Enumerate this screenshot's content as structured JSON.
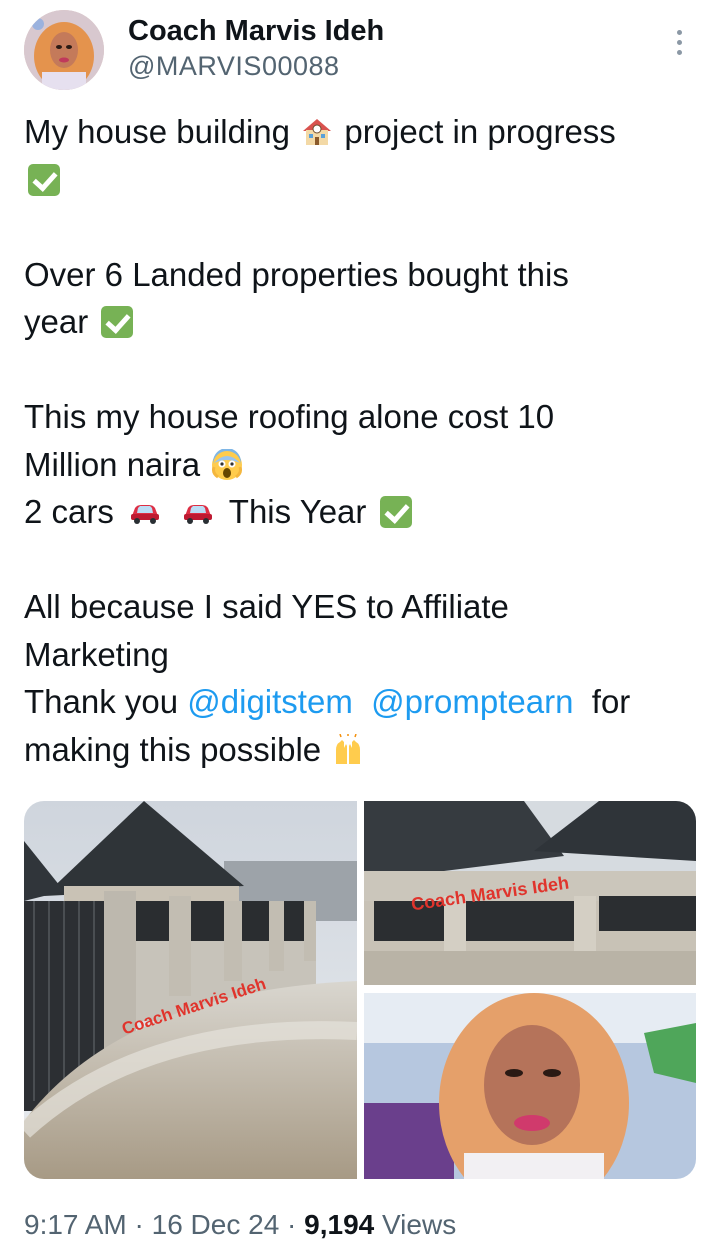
{
  "author": {
    "name": "Coach Marvis Ideh",
    "handle": "@MARVIS00088"
  },
  "tweet": {
    "line1_a": "My house building",
    "line1_b": "project in progress",
    "line2": "Over 6 Landed properties bought this",
    "line2_b": "year",
    "line3": "This my house roofing alone cost 10",
    "line3_b": "Million naira",
    "line4_a": "2 cars",
    "line4_b": "This Year",
    "line5": "All because I said YES to Affiliate",
    "line5_b": "Marketing",
    "line6_a": "Thank you",
    "mention1": "@digitstem",
    "mention2": "@promptearn",
    "line6_b": "for",
    "line7": "making this possible"
  },
  "media": {
    "watermark": "Coach Marvis Ideh",
    "watermark2": "Coach Marvis Ideh"
  },
  "meta": {
    "time": "9:17 AM",
    "sep1": "·",
    "date": "16 Dec 24",
    "sep2": "·",
    "views_count": "9,194",
    "views_label": "Views"
  },
  "icons": [
    "more-icon",
    "house-emoji",
    "check-emoji",
    "scream-emoji",
    "car-emoji",
    "raised-hands-emoji"
  ]
}
